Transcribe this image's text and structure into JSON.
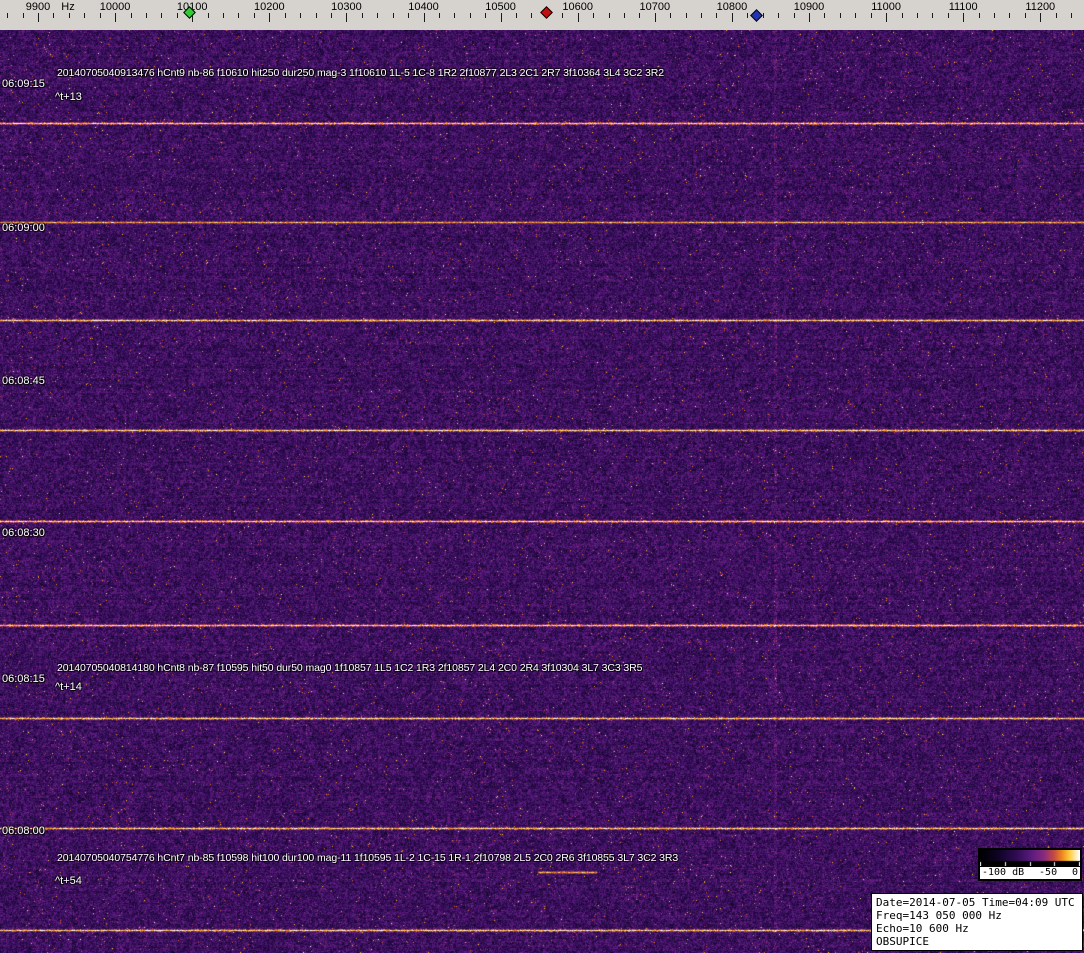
{
  "ruler": {
    "unit": "Hz",
    "labels": [
      "9900",
      "10000",
      "10100",
      "10200",
      "10300",
      "10400",
      "10500",
      "10600",
      "10700",
      "10800",
      "10900",
      "11000",
      "11100",
      "11200"
    ],
    "markers": [
      {
        "name": "green-diamond",
        "color": "#2ecc2e"
      },
      {
        "name": "red-diamond",
        "color": "#bb1111"
      },
      {
        "name": "blue-diamond",
        "color": "#2233bb"
      }
    ]
  },
  "waterfall": {
    "time_labels": [
      "06:09:15",
      "06:09:00",
      "06:08:45",
      "06:08:30",
      "06:08:15",
      "06:08:00"
    ],
    "annotations": [
      {
        "text": "20140705040913476 hCnt9 nb-86 f10610 hit250 dur250 mag-3 1f10610 1L-5 1C-8 1R2 2f10877 2L3 2C1 2R7 3f10364 3L4 3C2 3R2",
        "marker": "^t+13"
      },
      {
        "text": "20140705040814180 hCnt8 nb-87 f10595 hit50 dur50 mag0 1f10857 1L5 1C2 1R3 2f10857 2L4 2C0 2R4 3f10304 3L7 3C3 3R5",
        "marker": "^t+14"
      },
      {
        "text": "20140705040754776 hCnt7 nb-85 f10598 hit100 dur100 mag-11 1f10595 1L-2 1C-15 1R-1 2f10798 2L5 2C0 2R6 3f10855 3L7 3C2 3R3",
        "marker": "^t+54"
      }
    ]
  },
  "colorbar": {
    "labels": [
      "-100 dB",
      "-50",
      "0"
    ]
  },
  "infobox": {
    "lines": [
      "Date=2014-07-05 Time=04:09 UTC",
      "Freq=143 050 000 Hz",
      "Echo=10 600 Hz",
      "OBSUPICE"
    ]
  }
}
